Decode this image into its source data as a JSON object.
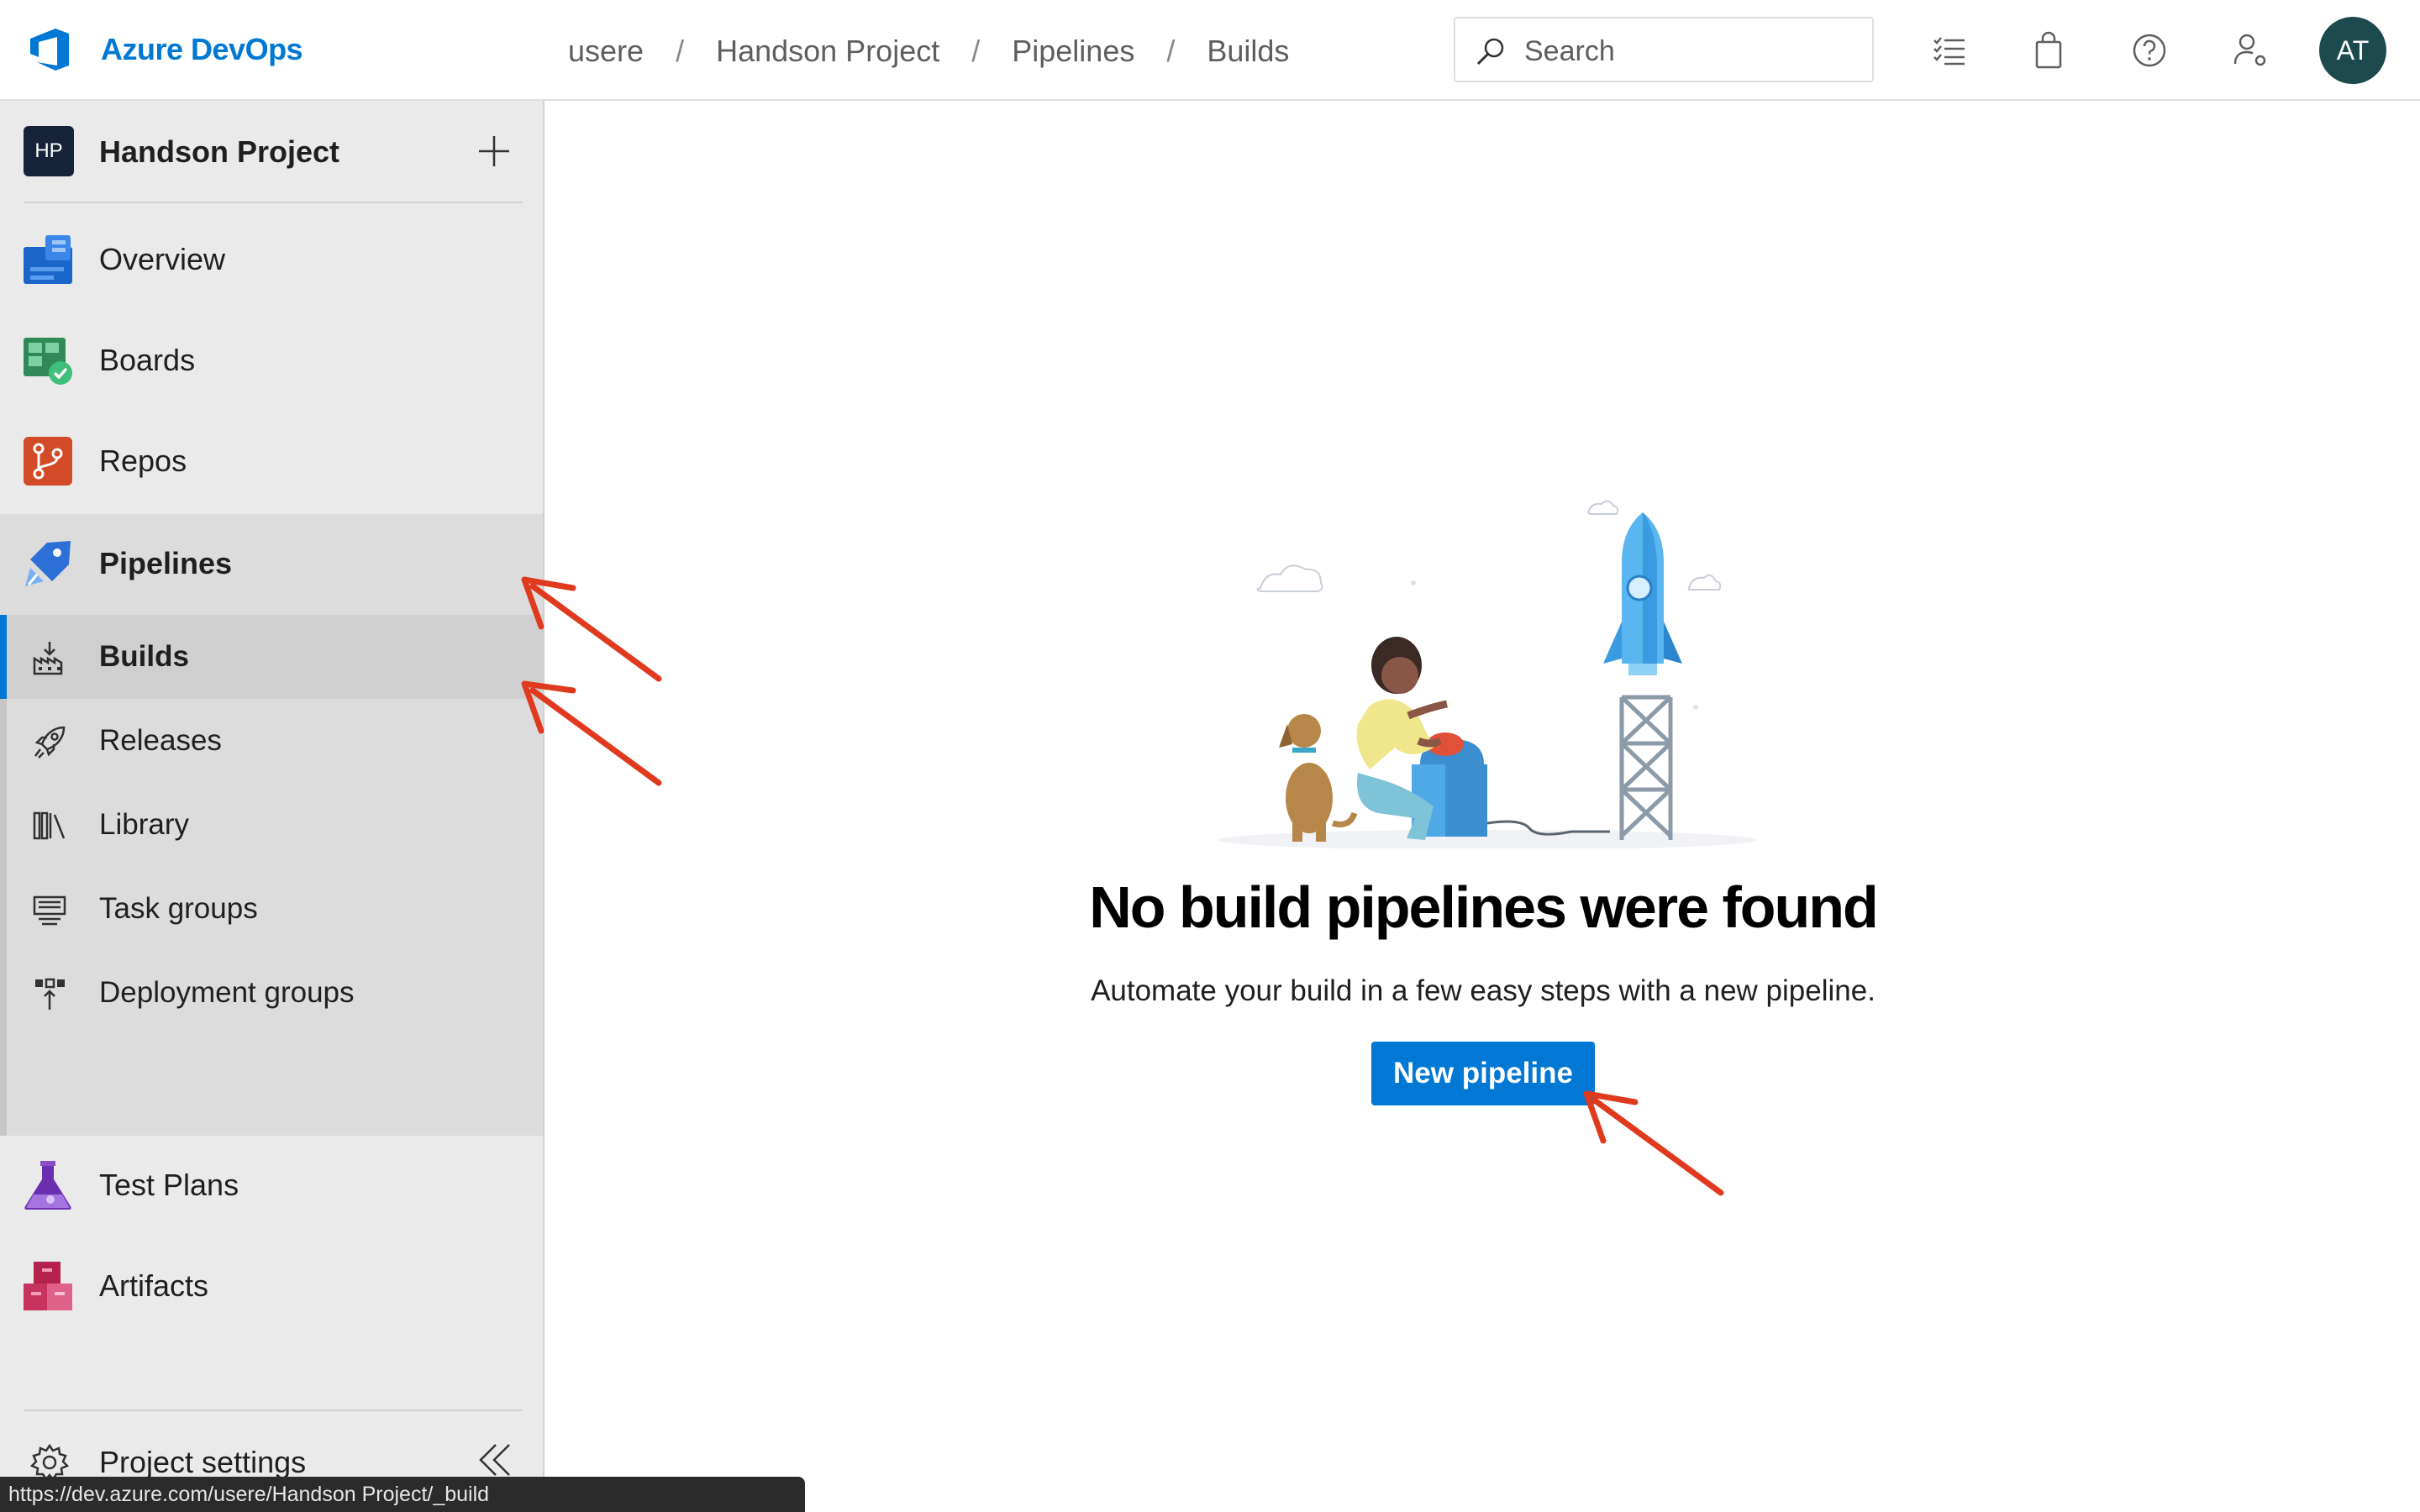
{
  "app": {
    "brand": "Azure DevOps"
  },
  "breadcrumb": [
    {
      "label": "usere"
    },
    {
      "label": "Handson Project"
    },
    {
      "label": "Pipelines"
    },
    {
      "label": "Builds"
    }
  ],
  "search": {
    "placeholder": "Search"
  },
  "user": {
    "initials": "AT"
  },
  "project": {
    "badge": "HP",
    "name": "Handson Project"
  },
  "nav": {
    "overview": "Overview",
    "boards": "Boards",
    "repos": "Repos",
    "pipelines": "Pipelines",
    "test_plans": "Test Plans",
    "artifacts": "Artifacts"
  },
  "pipelines_sub": [
    {
      "label": "Builds",
      "selected": true
    },
    {
      "label": "Releases"
    },
    {
      "label": "Library"
    },
    {
      "label": "Task groups"
    },
    {
      "label": "Deployment groups"
    }
  ],
  "footer": {
    "settings": "Project settings"
  },
  "status_url": "https://dev.azure.com/usere/Handson Project/_build",
  "empty_state": {
    "title": "No build pipelines were found",
    "description": "Automate your build in a few easy steps with a new pipeline.",
    "button": "New pipeline"
  },
  "colors": {
    "accent": "#0078d4",
    "annotation_arrow": "#e03a1e",
    "avatar_bg": "#1d4a4c",
    "sidebar_bg": "#eaeaea"
  }
}
